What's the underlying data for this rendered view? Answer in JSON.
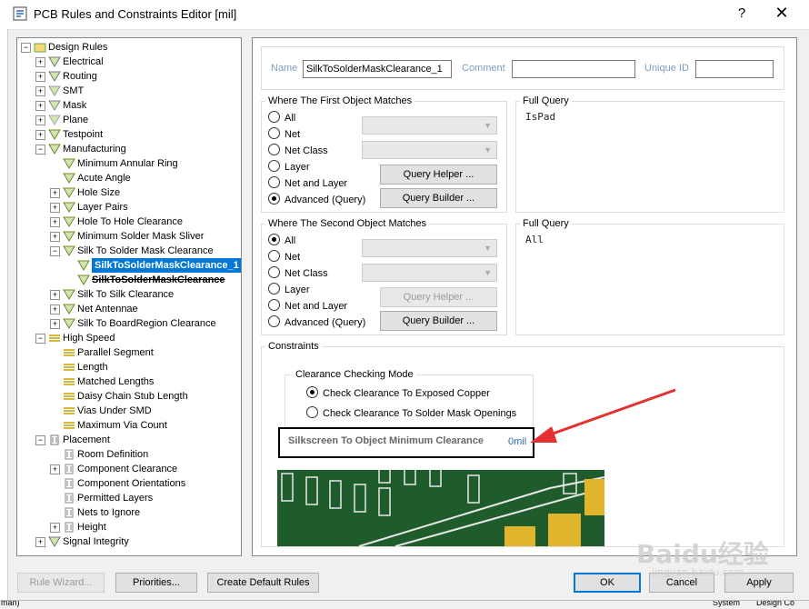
{
  "window": {
    "title": "PCB Rules and Constraints Editor [mil]",
    "help": "?",
    "close": "✕"
  },
  "tree": {
    "items": [
      {
        "label": "Design Rules",
        "level": 0,
        "expander": "−",
        "icon": "rules-root-icon",
        "color": "#6aa84f"
      },
      {
        "label": "Electrical",
        "level": 1,
        "expander": "+",
        "icon": "electrical-icon",
        "color": "#777"
      },
      {
        "label": "Routing",
        "level": 1,
        "expander": "+",
        "icon": "routing-icon",
        "color": "#777"
      },
      {
        "label": "SMT",
        "level": 1,
        "expander": "+",
        "icon": "smt-icon",
        "color": "#999"
      },
      {
        "label": "Mask",
        "level": 1,
        "expander": "+",
        "icon": "mask-icon",
        "color": "#888"
      },
      {
        "label": "Plane",
        "level": 1,
        "expander": "+",
        "icon": "plane-icon",
        "color": "#aaa"
      },
      {
        "label": "Testpoint",
        "level": 1,
        "expander": "+",
        "icon": "testpoint-icon",
        "color": "#6b8e23"
      },
      {
        "label": "Manufacturing",
        "level": 1,
        "expander": "−",
        "icon": "manufacturing-icon",
        "color": "#6b8e23"
      },
      {
        "label": "Minimum Annular Ring",
        "level": 2,
        "expander": "",
        "icon": "rule-icon",
        "color": "#6b8e23"
      },
      {
        "label": "Acute Angle",
        "level": 2,
        "expander": "",
        "icon": "rule-icon",
        "color": "#6b8e23"
      },
      {
        "label": "Hole Size",
        "level": 2,
        "expander": "+",
        "icon": "rule-icon",
        "color": "#6b8e23"
      },
      {
        "label": "Layer Pairs",
        "level": 2,
        "expander": "+",
        "icon": "rule-icon",
        "color": "#6b8e23"
      },
      {
        "label": "Hole To Hole Clearance",
        "level": 2,
        "expander": "+",
        "icon": "rule-icon",
        "color": "#6b8e23"
      },
      {
        "label": "Minimum Solder Mask Sliver",
        "level": 2,
        "expander": "+",
        "icon": "rule-icon",
        "color": "#6b8e23"
      },
      {
        "label": "Silk To Solder Mask Clearance",
        "level": 2,
        "expander": "−",
        "icon": "rule-icon",
        "color": "#6b8e23"
      },
      {
        "label": "SilkToSolderMaskClearance_1",
        "level": 3,
        "expander": "",
        "icon": "rule-icon",
        "color": "#6b8e23",
        "selected": true
      },
      {
        "label": "SilkToSolderMaskClearance",
        "level": 3,
        "expander": "",
        "icon": "rule-icon",
        "color": "#6b8e23",
        "bold": true
      },
      {
        "label": "Silk To Silk Clearance",
        "level": 2,
        "expander": "+",
        "icon": "rule-icon",
        "color": "#6b8e23"
      },
      {
        "label": "Net Antennae",
        "level": 2,
        "expander": "+",
        "icon": "rule-icon",
        "color": "#6b8e23"
      },
      {
        "label": "Silk To BoardRegion Clearance",
        "level": 2,
        "expander": "+",
        "icon": "rule-icon",
        "color": "#6b8e23"
      },
      {
        "label": "High Speed",
        "level": 1,
        "expander": "−",
        "icon": "high-speed-icon",
        "color": "#c9a400"
      },
      {
        "label": "Parallel Segment",
        "level": 2,
        "expander": "",
        "icon": "hs-rule-icon",
        "color": "#c9a400"
      },
      {
        "label": "Length",
        "level": 2,
        "expander": "",
        "icon": "hs-rule-icon",
        "color": "#c9a400"
      },
      {
        "label": "Matched Lengths",
        "level": 2,
        "expander": "",
        "icon": "hs-rule-icon",
        "color": "#c9a400"
      },
      {
        "label": "Daisy Chain Stub Length",
        "level": 2,
        "expander": "",
        "icon": "hs-rule-icon",
        "color": "#c9a400"
      },
      {
        "label": "Vias Under SMD",
        "level": 2,
        "expander": "",
        "icon": "hs-rule-icon",
        "color": "#c9a400"
      },
      {
        "label": "Maximum Via Count",
        "level": 2,
        "expander": "",
        "icon": "hs-rule-icon",
        "color": "#c9a400"
      },
      {
        "label": "Placement",
        "level": 1,
        "expander": "−",
        "icon": "placement-icon",
        "color": "#777"
      },
      {
        "label": "Room Definition",
        "level": 2,
        "expander": "",
        "icon": "placement-rule-icon",
        "color": "#888"
      },
      {
        "label": "Component Clearance",
        "level": 2,
        "expander": "+",
        "icon": "placement-rule-icon",
        "color": "#888"
      },
      {
        "label": "Component Orientations",
        "level": 2,
        "expander": "",
        "icon": "placement-rule-icon",
        "color": "#888"
      },
      {
        "label": "Permitted Layers",
        "level": 2,
        "expander": "",
        "icon": "placement-rule-icon",
        "color": "#888"
      },
      {
        "label": "Nets to Ignore",
        "level": 2,
        "expander": "",
        "icon": "placement-rule-icon",
        "color": "#888"
      },
      {
        "label": "Height",
        "level": 2,
        "expander": "+",
        "icon": "placement-rule-icon",
        "color": "#888"
      },
      {
        "label": "Signal Integrity",
        "level": 1,
        "expander": "+",
        "icon": "signal-integrity-icon",
        "color": "#777"
      }
    ]
  },
  "rule": {
    "name_label": "Name",
    "name_value": "SilkToSolderMaskClearance_1",
    "comment_label": "Comment",
    "comment_value": "",
    "uid_label": "Unique ID",
    "uid_value": ""
  },
  "first_match": {
    "title": "Where The First Object Matches",
    "options": [
      {
        "label": "All",
        "checked": false
      },
      {
        "label": "Net",
        "checked": false
      },
      {
        "label": "Net Class",
        "checked": false
      },
      {
        "label": "Layer",
        "checked": false
      },
      {
        "label": "Net and Layer",
        "checked": false
      },
      {
        "label": "Advanced (Query)",
        "checked": true
      }
    ],
    "query_helper": "Query Helper ...",
    "query_builder": "Query Builder ...",
    "full_query_title": "Full Query",
    "full_query": "IsPad"
  },
  "second_match": {
    "title": "Where The Second Object Matches",
    "options": [
      {
        "label": "All",
        "checked": true
      },
      {
        "label": "Net",
        "checked": false
      },
      {
        "label": "Net Class",
        "checked": false
      },
      {
        "label": "Layer",
        "checked": false
      },
      {
        "label": "Net and Layer",
        "checked": false
      },
      {
        "label": "Advanced (Query)",
        "checked": false
      }
    ],
    "query_helper": "Query Helper ...",
    "query_builder": "Query Builder ...",
    "full_query_title": "Full Query",
    "full_query": "All"
  },
  "constraints": {
    "title": "Constraints",
    "mode_title": "Clearance Checking Mode",
    "mode_options": [
      {
        "label": "Check Clearance To Exposed Copper",
        "checked": true
      },
      {
        "label": "Check Clearance To Solder Mask Openings",
        "checked": false
      }
    ],
    "min_clearance_label": "Silkscreen To Object Minimum Clearance",
    "min_clearance_value": "0mil"
  },
  "footer": {
    "rule_wizard": "Rule Wizard...",
    "priorities": "Priorities...",
    "create_default": "Create Default Rules",
    "ok": "OK",
    "cancel": "Cancel",
    "apply": "Apply"
  },
  "watermark": {
    "text": "Baidu经验",
    "sub": "jingyan.baidu.com"
  },
  "statusbar": {
    "left": "man)",
    "system": "System",
    "design": "Design Co"
  },
  "colors": {
    "accent": "#0078d7",
    "annotation_arrow": "#e53030",
    "pcb_green": "#1f5c2c",
    "pad_yellow": "#e0b52c"
  }
}
